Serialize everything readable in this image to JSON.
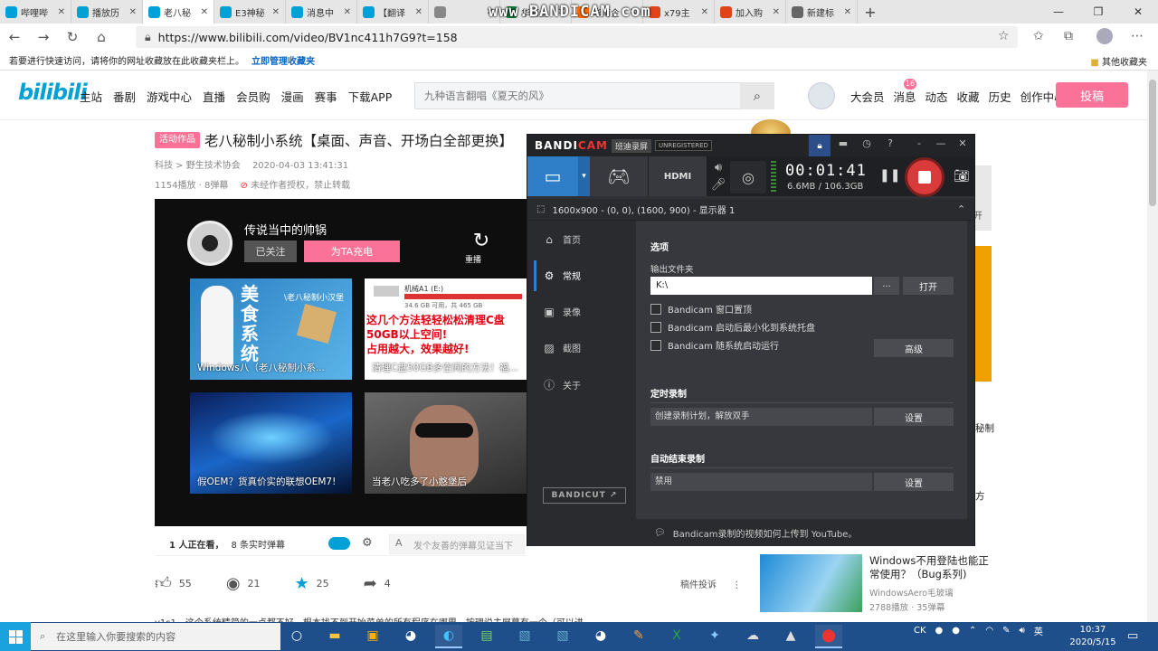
{
  "browser": {
    "tabs": [
      {
        "title": "哔哩哔",
        "icon_color": "#00a1d6",
        "active": false
      },
      {
        "title": "播放历",
        "icon_color": "#00a1d6",
        "active": false
      },
      {
        "title": "老八秘",
        "icon_color": "#00a1d6",
        "active": true
      },
      {
        "title": "E3神秘",
        "icon_color": "#00a1d6",
        "active": false
      },
      {
        "title": "消息中",
        "icon_color": "#00a1d6",
        "active": false
      },
      {
        "title": "【翻译",
        "icon_color": "#00a1d6",
        "active": false
      },
      {
        "title": "",
        "icon_color": "#888888",
        "active": false
      },
      {
        "title": "华南企",
        "icon_color": "#0b7a3b",
        "active": false
      },
      {
        "title": "华南企",
        "icon_color": "#ff6a00",
        "active": false
      },
      {
        "title": "x79主",
        "icon_color": "#e0441b",
        "active": false
      },
      {
        "title": "加入购",
        "icon_color": "#e0441b",
        "active": false
      },
      {
        "title": "新建标",
        "icon_color": "#666666",
        "active": false
      }
    ],
    "watermark": "www.BANDICAM.com",
    "url": "https://www.bilibili.com/video/BV1nc411h7G9?t=158",
    "favorites_hint": "若要进行快速访问，请将你的网址收藏放在此收藏夹栏上。",
    "favorites_link": "立即管理收藏夹",
    "other_favorites": "其他收藏夹"
  },
  "bili": {
    "logo": "bilibili",
    "nav": [
      "主站",
      "番剧",
      "游戏中心",
      "直播",
      "会员购",
      "漫画",
      "赛事",
      "下载APP"
    ],
    "search_placeholder": "九种语言翻唱《夏天的风》",
    "right_nav": [
      "大会员",
      "消息",
      "动态",
      "收藏",
      "历史",
      "创作中心"
    ],
    "message_badge": "16",
    "upload": "投稿"
  },
  "video": {
    "tag": "活动作品",
    "title": "老八秘制小系统【桌面、声音、开场白全部更换】",
    "category": "科技 > 野生技术协会",
    "date": "2020-04-03 13:41:31",
    "plays": "1154播放 · 8弹幕",
    "copyright": "未经作者授权，禁止转载",
    "up_name": "传说当中的帅锅",
    "followed": "已关注",
    "charge": "为TA充电",
    "replay": "重播",
    "related": [
      {
        "title": "Windows八（老八秘制小系..."
      },
      {
        "title": "清理C盘50GB多空间的方法！福..."
      },
      {
        "title": "假OEM？货真价实的联想OEM7!"
      },
      {
        "title": "当老八吃多了小憨堡后"
      }
    ],
    "t1_big": "美食系统",
    "t1_small": "\\老八秘制小汉堡",
    "t2_drive": "机械A1 (E:)",
    "t2_drive_sub": "34.6 GB 可用，共 465 GB",
    "t2_lines": [
      "这几个方法轻轻松松清理C盘",
      "50GB以上空间!",
      "占用越大，效果越好!"
    ],
    "viewers": "1 人正在看，",
    "danmaku_count": "8 条实时弹幕",
    "danmaku_placeholder": "发个友善的弹幕见证当下",
    "likes": "55",
    "coins": "21",
    "favs": "25",
    "shares": "4",
    "report": "稿件投诉",
    "comment_preview": "v1s1，这个系统精简的一点都不好，根本找不到开始菜单的所有程序在哪里，按理说主屏幕有一个（可以进"
  },
  "sidebar": {
    "rec_title": "Windows不用登陆也能正常使用？（Bug系列)",
    "rec_up": "WindowsAero毛玻璃",
    "rec_stats": "2788播放 · 35弹幕",
    "frag1": "秘制",
    "frag2": "方",
    "frag3": "开"
  },
  "bandicam": {
    "logo_a": "BANDI",
    "logo_b": "CAM",
    "mode": "班迪录屏",
    "unregistered": "UNREGISTERED",
    "timer": "00:01:41",
    "size": "6.6MB / 106.3GB",
    "resolution": "1600x900 - (0, 0), (1600, 900) - 显示器 1",
    "nav": [
      "首页",
      "常规",
      "录像",
      "截图",
      "关于"
    ],
    "section_options": "选项",
    "output_label": "输出文件夹",
    "output_path": "K:\\",
    "browse": "...",
    "open": "打开",
    "checks": [
      "Bandicam 窗口置顶",
      "Bandicam 启动后最小化到系统托盘",
      "Bandicam 随系统启动运行"
    ],
    "advanced": "高级",
    "section_timer": "定时录制",
    "timer_field": "创建录制计划，解放双手",
    "timer_btn": "设置",
    "section_autostop": "自动结束录制",
    "autostop_field": "禁用",
    "autostop_btn": "设置",
    "bandicut": "BANDICUT",
    "footer": "Bandicam录制的视频如何上传到 YouTube。",
    "hdmi": "HDMI"
  },
  "taskbar": {
    "search_placeholder": "在这里输入你要搜索的内容",
    "time": "10:37",
    "date": "2020/5/15",
    "ime": "CK",
    "lang": "英"
  }
}
